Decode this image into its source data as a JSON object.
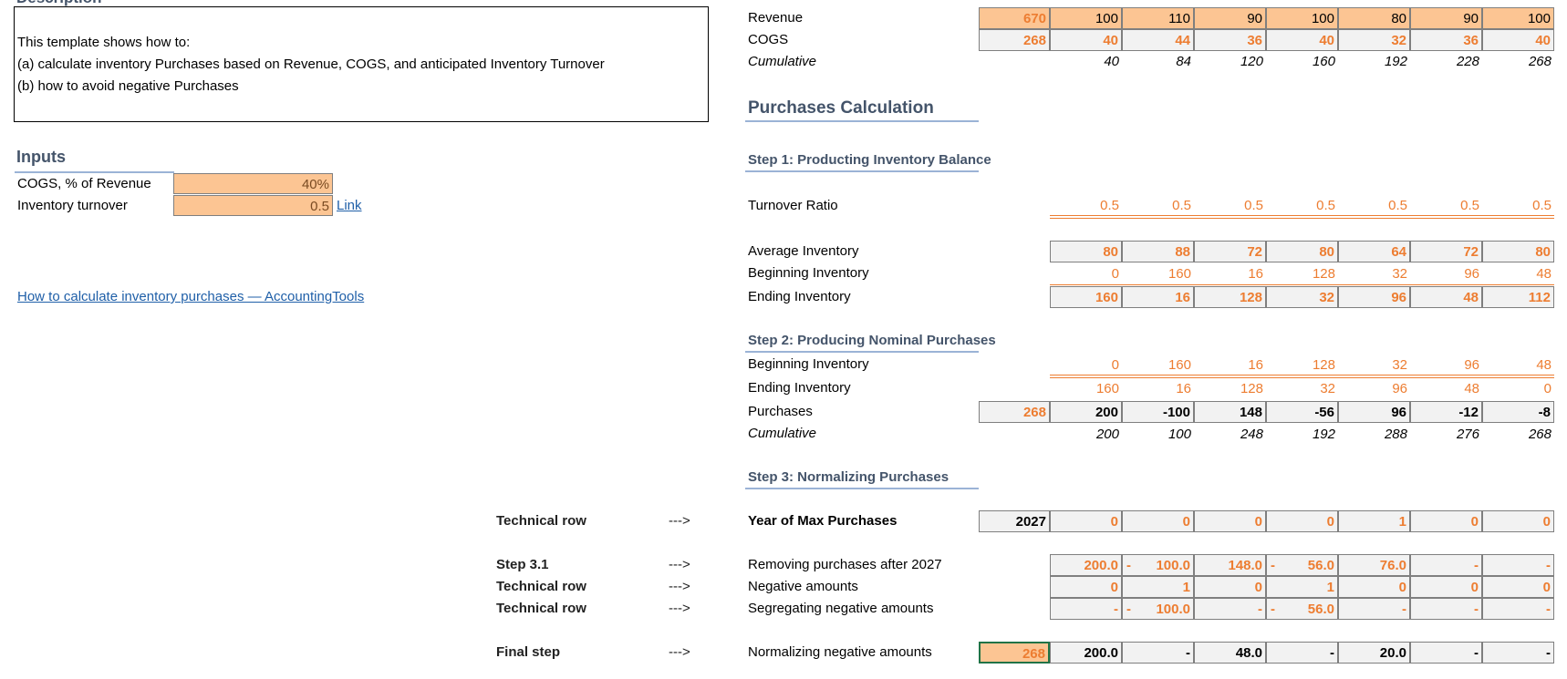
{
  "description": {
    "title": "Description",
    "lines": [
      "This template shows how to:",
      "(a) calculate inventory Purchases based on Revenue, COGS, and anticipated Inventory Turnover",
      "(b) how to avoid negative Purchases"
    ]
  },
  "inputs": {
    "title": "Inputs",
    "cogs_label": "COGS, % of Revenue",
    "cogs_value": "40%",
    "turnover_label": "Inventory turnover",
    "turnover_value": "0.5",
    "link_text": "Link",
    "reference_link": "How to calculate inventory purchases — AccountingTools"
  },
  "top": {
    "revenue_label": "Revenue",
    "revenue_total": "670",
    "revenue": [
      "100",
      "110",
      "90",
      "100",
      "80",
      "90",
      "100"
    ],
    "cogs_label": "COGS",
    "cogs_total": "268",
    "cogs": [
      "40",
      "44",
      "36",
      "40",
      "32",
      "36",
      "40"
    ],
    "cumulative_label": "Cumulative",
    "cumulative": [
      "40",
      "84",
      "120",
      "160",
      "192",
      "228",
      "268"
    ]
  },
  "purchases_calc": {
    "title": "Purchases Calculation"
  },
  "step1": {
    "title": "Step 1: Producting Inventory Balance",
    "turnover_label": "Turnover Ratio",
    "turnover": [
      "0.5",
      "0.5",
      "0.5",
      "0.5",
      "0.5",
      "0.5",
      "0.5"
    ],
    "avg_label": "Average Inventory",
    "avg": [
      "80",
      "88",
      "72",
      "80",
      "64",
      "72",
      "80"
    ],
    "beg_label": "Beginning Inventory",
    "beg": [
      "0",
      "160",
      "16",
      "128",
      "32",
      "96",
      "48"
    ],
    "end_label": "Ending Inventory",
    "end": [
      "160",
      "16",
      "128",
      "32",
      "96",
      "48",
      "112"
    ]
  },
  "step2": {
    "title": "Step 2: Producing Nominal Purchases",
    "beg_label": "Beginning Inventory",
    "beg": [
      "0",
      "160",
      "16",
      "128",
      "32",
      "96",
      "48"
    ],
    "end_label": "Ending Inventory",
    "end": [
      "160",
      "16",
      "128",
      "32",
      "96",
      "48",
      "0"
    ],
    "purch_label": "Purchases",
    "purch_total": "268",
    "purch": [
      "200",
      "-100",
      "148",
      "-56",
      "96",
      "-12",
      "-8"
    ],
    "cum_label": "Cumulative",
    "cum": [
      "200",
      "100",
      "248",
      "192",
      "288",
      "276",
      "268"
    ]
  },
  "step3": {
    "title": "Step 3: Normalizing Purchases",
    "tech_row_1": "Technical row",
    "arrow": "--->",
    "year_label": "Year of Max Purchases",
    "year_total": "2027",
    "year": [
      "0",
      "0",
      "0",
      "0",
      "1",
      "0",
      "0"
    ],
    "step31": "Step 3.1",
    "remove_label": "Removing purchases after 2027",
    "remove": [
      "200.0",
      "100.0",
      "148.0",
      "56.0",
      "76.0",
      "-",
      "-"
    ],
    "remove_neg": [
      false,
      true,
      false,
      true,
      false,
      false,
      false
    ],
    "tech_row_2": "Technical row",
    "neg_label": "Negative amounts",
    "neg": [
      "0",
      "1",
      "0",
      "1",
      "0",
      "0",
      "0"
    ],
    "tech_row_3": "Technical row",
    "seg_label": "Segregating negative amounts",
    "seg": [
      "-",
      "100.0",
      "-",
      "56.0",
      "-",
      "-",
      "-"
    ],
    "seg_neg": [
      false,
      true,
      false,
      true,
      false,
      false,
      false
    ],
    "final_step": "Final step",
    "norm_label": "Normalizing negative amounts",
    "norm_total": "268",
    "norm": [
      "200.0",
      "-",
      "48.0",
      "-",
      "20.0",
      "-",
      "-"
    ]
  }
}
